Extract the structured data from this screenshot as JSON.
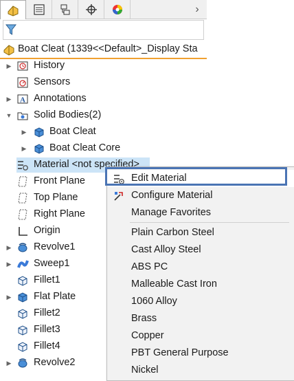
{
  "tabs": [
    {
      "name": "feature-manager-tab-icon"
    },
    {
      "name": "property-manager-tab-icon"
    },
    {
      "name": "configuration-manager-tab-icon"
    },
    {
      "name": "dimxpert-manager-tab-icon"
    },
    {
      "name": "display-manager-tab-icon"
    }
  ],
  "tab_scroll": "›",
  "root": {
    "label": "Boat Cleat  (1339<<Default>_Display Sta"
  },
  "tree": [
    {
      "label": "History",
      "icon": "history-icon",
      "arrow": "▶"
    },
    {
      "label": "Sensors",
      "icon": "sensors-icon",
      "arrow": ""
    },
    {
      "label": "Annotations",
      "icon": "annotations-icon",
      "arrow": "▶"
    },
    {
      "label": "Solid Bodies(2)",
      "icon": "solid-bodies-folder-icon",
      "arrow": "▼"
    },
    {
      "label": "Boat Cleat",
      "icon": "solid-body-icon",
      "arrow": "▶"
    },
    {
      "label": "Boat Cleat Core",
      "icon": "solid-body-icon",
      "arrow": "▶"
    },
    {
      "label": "Material <not specified>",
      "icon": "material-icon",
      "arrow": ""
    },
    {
      "label": "Front Plane",
      "icon": "plane-icon",
      "arrow": ""
    },
    {
      "label": "Top Plane",
      "icon": "plane-icon",
      "arrow": ""
    },
    {
      "label": "Right Plane",
      "icon": "plane-icon",
      "arrow": ""
    },
    {
      "label": "Origin",
      "icon": "origin-icon",
      "arrow": ""
    },
    {
      "label": "Revolve1",
      "icon": "revolve-icon",
      "arrow": "▶"
    },
    {
      "label": "Sweep1",
      "icon": "sweep-icon",
      "arrow": "▶"
    },
    {
      "label": "Fillet1",
      "icon": "fillet-icon",
      "arrow": ""
    },
    {
      "label": "Flat Plate",
      "icon": "extrude-icon",
      "arrow": "▶"
    },
    {
      "label": "Fillet2",
      "icon": "fillet-icon",
      "arrow": ""
    },
    {
      "label": "Fillet3",
      "icon": "fillet-icon",
      "arrow": ""
    },
    {
      "label": "Fillet4",
      "icon": "fillet-icon",
      "arrow": ""
    },
    {
      "label": "Revolve2",
      "icon": "revolve-icon",
      "arrow": "▶"
    }
  ],
  "menu": {
    "actions": [
      {
        "label": "Edit Material",
        "icon": "edit-material-icon"
      },
      {
        "label": "Configure Material",
        "icon": "configure-material-icon"
      },
      {
        "label": "Manage Favorites",
        "icon": ""
      }
    ],
    "materials": [
      "Plain Carbon Steel",
      "Cast Alloy Steel",
      "ABS PC",
      "Malleable Cast Iron",
      "1060 Alloy",
      "Brass",
      "Copper",
      "PBT General Purpose",
      "Nickel"
    ]
  },
  "colors": {
    "accent": "#4a74b4",
    "selection": "#cce4f7",
    "root_underline": "#f0a030"
  }
}
